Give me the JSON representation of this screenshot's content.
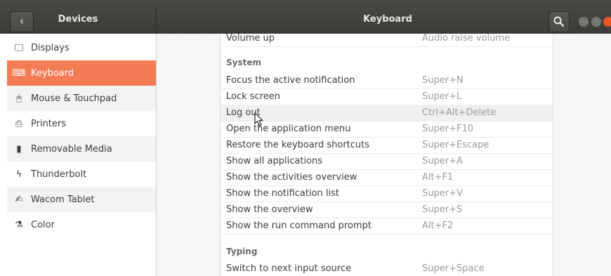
{
  "titlebar": {
    "sidebar_title": "Devices",
    "main_title": "Keyboard",
    "icons": {
      "back": "chevron-left-icon",
      "search": "search-icon"
    }
  },
  "sidebar": {
    "items": [
      {
        "label": "Displays",
        "icon": "display-icon"
      },
      {
        "label": "Keyboard",
        "icon": "keyboard-icon",
        "active": true
      },
      {
        "label": "Mouse & Touchpad",
        "icon": "mouse-icon"
      },
      {
        "label": "Printers",
        "icon": "printer-icon"
      },
      {
        "label": "Removable Media",
        "icon": "removable-media-icon"
      },
      {
        "label": "Thunderbolt",
        "icon": "thunderbolt-icon"
      },
      {
        "label": "Wacom Tablet",
        "icon": "tablet-icon"
      },
      {
        "label": "Color",
        "icon": "color-icon"
      }
    ]
  },
  "shortcuts": {
    "top_row": {
      "name": "Volume up",
      "key": "Audio raise volume"
    },
    "system_label": "System",
    "system": [
      {
        "name": "Focus the active notification",
        "key": "Super+N"
      },
      {
        "name": "Lock screen",
        "key": "Super+L"
      },
      {
        "name": "Log out",
        "key": "Ctrl+Alt+Delete"
      },
      {
        "name": "Open the application menu",
        "key": "Super+F10"
      },
      {
        "name": "Restore the keyboard shortcuts",
        "key": "Super+Escape"
      },
      {
        "name": "Show all applications",
        "key": "Super+A"
      },
      {
        "name": "Show the activities overview",
        "key": "Alt+F1"
      },
      {
        "name": "Show the notification list",
        "key": "Super+V"
      },
      {
        "name": "Show the overview",
        "key": "Super+S"
      },
      {
        "name": "Show the run command prompt",
        "key": "Alt+F2"
      }
    ],
    "typing_label": "Typing",
    "typing": [
      {
        "name": "Switch to next input source",
        "key": "Super+Space"
      }
    ]
  },
  "colors": {
    "accent": "#f37c55",
    "titlebar": "#3c3b37",
    "close": "#e95420"
  }
}
